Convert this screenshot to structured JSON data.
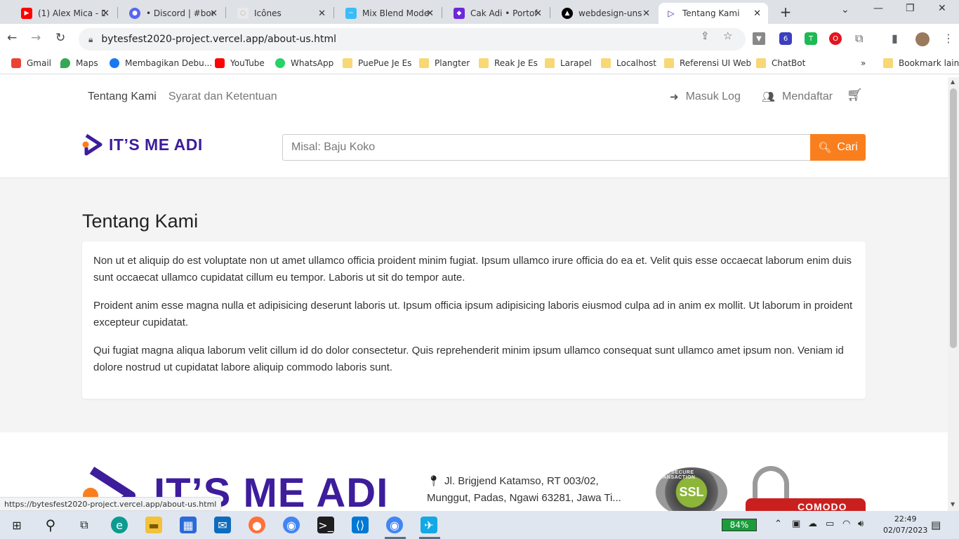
{
  "browser": {
    "tabs": [
      {
        "title": "(1) Alex Mica - D",
        "favicon": "youtube-icon",
        "color": "#ff0000"
      },
      {
        "title": "• Discord | #boo",
        "favicon": "discord-icon",
        "color": "#5865f2"
      },
      {
        "title": "Icônes",
        "favicon": "icones-icon",
        "color": "#cccccc"
      },
      {
        "title": "Mix Blend Mode",
        "favicon": "tailwind-icon",
        "color": "#38bdf8"
      },
      {
        "title": "Cak Adi • Portof",
        "favicon": "portfolio-icon",
        "color": "#6d28d9"
      },
      {
        "title": "webdesign-uns",
        "favicon": "vercel-icon",
        "color": "#000000"
      },
      {
        "title": "Tentang Kami",
        "favicon": "itsmeadi-icon",
        "color": "#3d1d9c"
      }
    ],
    "url": "bytesfest2020-project.vercel.app/about-us.html",
    "bookmarks": [
      {
        "label": "Gmail",
        "icon": "gmail-icon"
      },
      {
        "label": "Maps",
        "icon": "maps-icon"
      },
      {
        "label": "Membagikan Debu...",
        "icon": "facebook-icon"
      },
      {
        "label": "YouTube",
        "icon": "youtube-icon"
      },
      {
        "label": "WhatsApp",
        "icon": "whatsapp-icon"
      },
      {
        "label": "PuePue Je Es",
        "icon": "folder-icon"
      },
      {
        "label": "Plangter",
        "icon": "folder-icon"
      },
      {
        "label": "Reak Je Es",
        "icon": "folder-icon"
      },
      {
        "label": "Larapel",
        "icon": "folder-icon"
      },
      {
        "label": "Localhost",
        "icon": "folder-icon"
      },
      {
        "label": "Referensi UI Web",
        "icon": "folder-icon"
      },
      {
        "label": "ChatBot",
        "icon": "folder-icon"
      }
    ],
    "bookmarks_more": "»",
    "other_bookmarks": "Bookmark lain",
    "extension_badge": "6",
    "status_url": "https://bytesfest2020-project.vercel.app/about-us.html"
  },
  "header": {
    "nav": [
      "Tentang Kami",
      "Syarat dan Ketentuan"
    ],
    "login": "Masuk Log",
    "register": "Mendaftar",
    "logo_text": "IT’S ME ADI",
    "search_placeholder": "Misal: Baju Koko",
    "search_button": "Cari"
  },
  "main": {
    "title": "Tentang Kami",
    "paragraphs": [
      "Non ut et aliquip do est voluptate non ut amet ullamco officia proident minim fugiat. Ipsum ullamco irure officia do ea et. Velit quis esse occaecat laborum enim duis sunt occaecat ullamco cupidatat cillum eu tempor. Laboris ut sit do tempor aute.",
      "Proident anim esse magna nulla et adipisicing deserunt laboris ut. Ipsum officia ipsum adipisicing laboris eiusmod culpa ad in anim ex mollit. Ut laborum in proident excepteur cupidatat.",
      "Qui fugiat magna aliqua laborum velit cillum id do dolor consectetur. Quis reprehenderit minim ipsum ullamco consequat sunt ullamco amet ipsum non. Veniam id dolore nostrud ut cupidatat labore aliquip commodo laboris sunt."
    ]
  },
  "footer": {
    "logo_text": "IT’S ME ADI",
    "address": "Jl. Brigjend Katamso, RT 003/02, Munggut, Padas, Ngawi 63281, Jawa Ti...",
    "ssl_badge": "SSL",
    "ssl_ring": "100% SECURE TRANSACTION",
    "comodo_badge": "COMODO"
  },
  "taskbar": {
    "battery": "84%",
    "time": "22:49",
    "date": "02/07/2023"
  },
  "colors": {
    "brand": "#3d1d9c",
    "accent": "#f97f1e",
    "page_bg": "#f4f4f4"
  }
}
